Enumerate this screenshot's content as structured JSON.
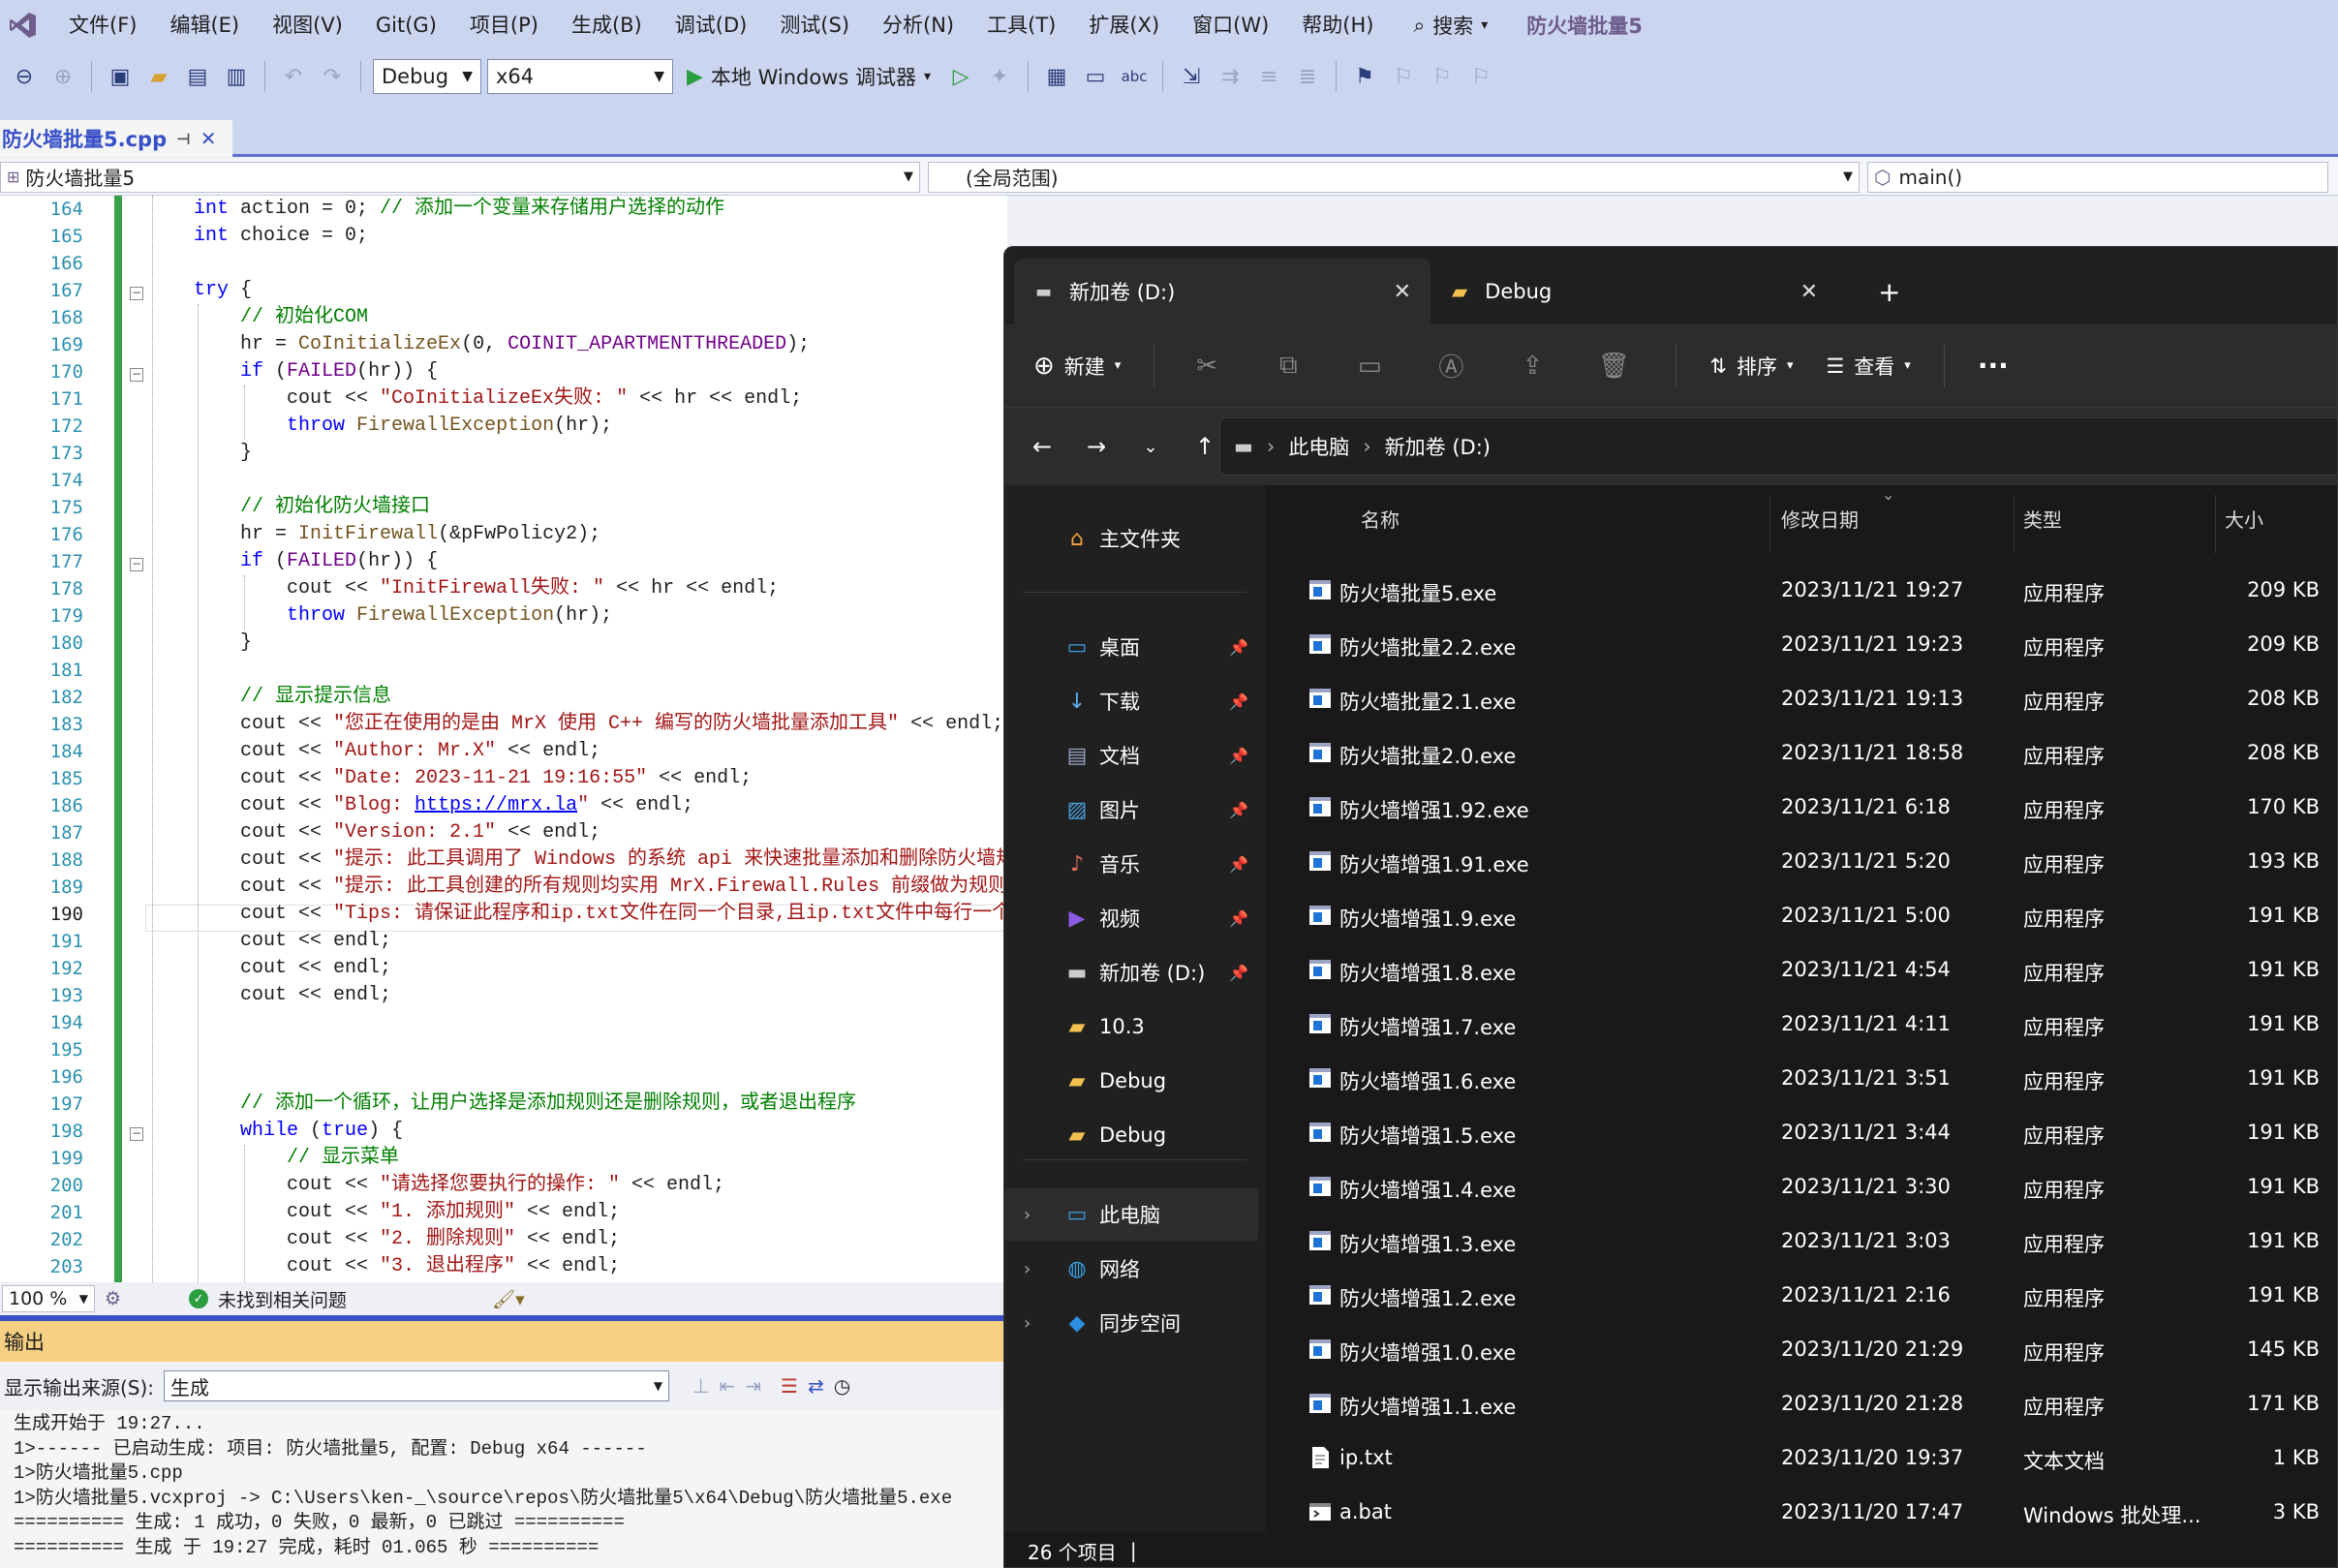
{
  "menubar": {
    "items": [
      "文件(F)",
      "编辑(E)",
      "视图(V)",
      "Git(G)",
      "项目(P)",
      "生成(B)",
      "调试(D)",
      "测试(S)",
      "分析(N)",
      "工具(T)",
      "扩展(X)",
      "窗口(W)",
      "帮助(H)"
    ],
    "search": "搜索",
    "solution_name": "防火墙批量5"
  },
  "toolbar": {
    "config": "Debug",
    "platform": "x64",
    "run_label": "本地 Windows 调试器"
  },
  "doctab": {
    "filename": "防火墙批量5.cpp"
  },
  "navbar": {
    "project": "防火墙批量5",
    "scope": "(全局范围)",
    "member": "main()"
  },
  "editor": {
    "line_numbers": [
      "164",
      "165",
      "166",
      "167",
      "168",
      "169",
      "170",
      "171",
      "172",
      "173",
      "174",
      "175",
      "176",
      "177",
      "178",
      "179",
      "180",
      "181",
      "182",
      "183",
      "184",
      "185",
      "186",
      "187",
      "188",
      "189",
      "190",
      "191",
      "192",
      "193",
      "194",
      "195",
      "196",
      "197",
      "198",
      "199",
      "200",
      "201",
      "202",
      "203"
    ],
    "current_line": "190"
  },
  "editor_status": {
    "zoom": "100 %",
    "issues": "未找到相关问题"
  },
  "output": {
    "title": "输出",
    "source_label": "显示输出来源(S):",
    "source_value": "生成",
    "lines": [
      "生成开始于 19:27...",
      "1>------ 已启动生成: 项目: 防火墙批量5, 配置: Debug x64 ------",
      "1>防火墙批量5.cpp",
      "1>防火墙批量5.vcxproj -> C:\\Users\\ken-_\\source\\repos\\防火墙批量5\\x64\\Debug\\防火墙批量5.exe",
      "========== 生成: 1 成功，0 失败，0 最新，0 已跳过 ==========",
      "========== 生成 于 19:27 完成，耗时 01.065 秒 =========="
    ]
  },
  "explorer": {
    "tabs": [
      "新加卷 (D:)",
      "Debug"
    ],
    "commands": {
      "new": "新建",
      "sort": "排序",
      "view": "查看"
    },
    "breadcrumb": [
      "此电脑",
      "新加卷 (D:)"
    ],
    "nav": {
      "home": "主文件夹",
      "pinned": [
        "桌面",
        "下载",
        "文档",
        "图片",
        "音乐",
        "视频",
        "新加卷 (D:)"
      ],
      "folders": [
        "10.3",
        "Debug",
        "Debug"
      ],
      "roots": [
        "此电脑",
        "网络",
        "同步空间"
      ]
    },
    "columns": [
      "名称",
      "修改日期",
      "类型",
      "大小"
    ],
    "files": [
      {
        "name": "防火墙批量5.exe",
        "date": "2023/11/21 19:27",
        "type": "应用程序",
        "size": "209 KB",
        "icon": "exe"
      },
      {
        "name": "防火墙批量2.2.exe",
        "date": "2023/11/21 19:23",
        "type": "应用程序",
        "size": "209 KB",
        "icon": "exe"
      },
      {
        "name": "防火墙批量2.1.exe",
        "date": "2023/11/21 19:13",
        "type": "应用程序",
        "size": "208 KB",
        "icon": "exe"
      },
      {
        "name": "防火墙批量2.0.exe",
        "date": "2023/11/21 18:58",
        "type": "应用程序",
        "size": "208 KB",
        "icon": "exe"
      },
      {
        "name": "防火墙增强1.92.exe",
        "date": "2023/11/21 6:18",
        "type": "应用程序",
        "size": "170 KB",
        "icon": "exe"
      },
      {
        "name": "防火墙增强1.91.exe",
        "date": "2023/11/21 5:20",
        "type": "应用程序",
        "size": "193 KB",
        "icon": "exe"
      },
      {
        "name": "防火墙增强1.9.exe",
        "date": "2023/11/21 5:00",
        "type": "应用程序",
        "size": "191 KB",
        "icon": "exe"
      },
      {
        "name": "防火墙增强1.8.exe",
        "date": "2023/11/21 4:54",
        "type": "应用程序",
        "size": "191 KB",
        "icon": "exe"
      },
      {
        "name": "防火墙增强1.7.exe",
        "date": "2023/11/21 4:11",
        "type": "应用程序",
        "size": "191 KB",
        "icon": "exe"
      },
      {
        "name": "防火墙增强1.6.exe",
        "date": "2023/11/21 3:51",
        "type": "应用程序",
        "size": "191 KB",
        "icon": "exe"
      },
      {
        "name": "防火墙增强1.5.exe",
        "date": "2023/11/21 3:44",
        "type": "应用程序",
        "size": "191 KB",
        "icon": "exe"
      },
      {
        "name": "防火墙增强1.4.exe",
        "date": "2023/11/21 3:30",
        "type": "应用程序",
        "size": "191 KB",
        "icon": "exe"
      },
      {
        "name": "防火墙增强1.3.exe",
        "date": "2023/11/21 3:03",
        "type": "应用程序",
        "size": "191 KB",
        "icon": "exe"
      },
      {
        "name": "防火墙增强1.2.exe",
        "date": "2023/11/21 2:16",
        "type": "应用程序",
        "size": "191 KB",
        "icon": "exe"
      },
      {
        "name": "防火墙增强1.0.exe",
        "date": "2023/11/20 21:29",
        "type": "应用程序",
        "size": "145 KB",
        "icon": "exe"
      },
      {
        "name": "防火墙增强1.1.exe",
        "date": "2023/11/20 21:28",
        "type": "应用程序",
        "size": "171 KB",
        "icon": "exe"
      },
      {
        "name": "ip.txt",
        "date": "2023/11/20 19:37",
        "type": "文本文档",
        "size": "1 KB",
        "icon": "txt"
      },
      {
        "name": "a.bat",
        "date": "2023/11/20 17:47",
        "type": "Windows 批处理...",
        "size": "3 KB",
        "icon": "bat"
      }
    ],
    "status": "26 个项目"
  },
  "colors": {
    "vs_chrome": "#ccd5f0",
    "accent": "#3750c8",
    "output_title": "#f5cf82",
    "explorer_bg": "#191919"
  }
}
